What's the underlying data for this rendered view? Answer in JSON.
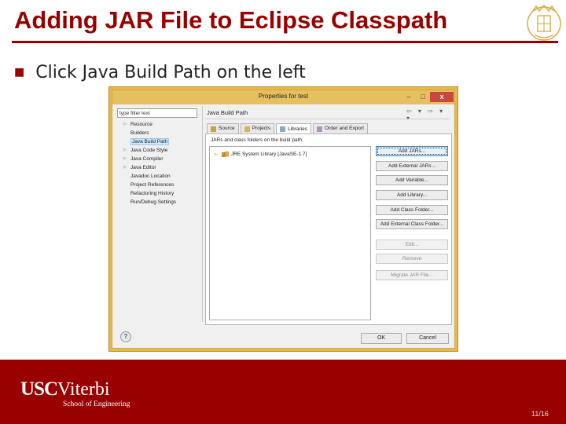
{
  "slide": {
    "title": "Adding JAR File to Eclipse Classpath",
    "bullet": "Click Java Build Path on the left",
    "page_number": "11/16"
  },
  "footer": {
    "logo_usc": "USC",
    "logo_viterbi": "Viterbi",
    "logo_sub": "School of Engineering"
  },
  "dialog": {
    "title": "Properties for test",
    "filter_placeholder": "type filter text",
    "tree_items": [
      {
        "label": "Resource",
        "expandable": true
      },
      {
        "label": "Builders",
        "expandable": false
      },
      {
        "label": "Java Build Path",
        "expandable": false,
        "selected": true
      },
      {
        "label": "Java Code Style",
        "expandable": true
      },
      {
        "label": "Java Compiler",
        "expandable": true
      },
      {
        "label": "Java Editor",
        "expandable": true
      },
      {
        "label": "Javadoc Location",
        "expandable": false
      },
      {
        "label": "Project References",
        "expandable": false
      },
      {
        "label": "Refactoring History",
        "expandable": false
      },
      {
        "label": "Run/Debug Settings",
        "expandable": false
      }
    ],
    "section_title": "Java Build Path",
    "tabs": [
      {
        "label": "Source",
        "active": false
      },
      {
        "label": "Projects",
        "active": false
      },
      {
        "label": "Libraries",
        "active": true
      },
      {
        "label": "Order and Export",
        "active": false
      }
    ],
    "panel_label": "JARs and class folders on the build path:",
    "list_items": [
      "JRE System Library [JavaSE-1.7]"
    ],
    "side_buttons": [
      {
        "label": "Add JARs...",
        "state": "focused"
      },
      {
        "label": "Add External JARs...",
        "state": "normal"
      },
      {
        "label": "Add Variable...",
        "state": "normal"
      },
      {
        "label": "Add Library...",
        "state": "normal"
      },
      {
        "label": "Add Class Folder...",
        "state": "normal"
      },
      {
        "label": "Add External Class Folder...",
        "state": "normal"
      },
      {
        "label": "Edit...",
        "state": "disabled"
      },
      {
        "label": "Remove",
        "state": "disabled"
      },
      {
        "label": "Migrate JAR File...",
        "state": "disabled"
      }
    ],
    "ok_label": "OK",
    "cancel_label": "Cancel",
    "window_controls": {
      "minimize": "–",
      "maximize": "□",
      "close": "x"
    },
    "nav_icons": "⇦ ▾ ⇨ ▾ ▾",
    "help_glyph": "?"
  },
  "colors": {
    "brand_cardinal": "#990000",
    "window_gold": "#e6c060",
    "selection": "#cde8ff"
  }
}
